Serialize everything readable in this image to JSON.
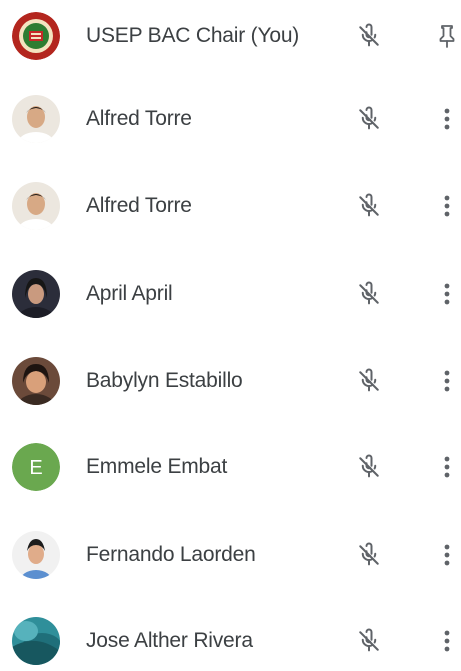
{
  "participants": [
    {
      "name": "USEP BAC Chair (You)",
      "avatar": "usep-seal",
      "mic": "mic-off-icon",
      "action": "pin-icon"
    },
    {
      "name": "Alfred Torre",
      "avatar": "photo",
      "mic": "mic-off-icon",
      "action": "more-vert-icon"
    },
    {
      "name": "Alfred Torre",
      "avatar": "photo",
      "mic": "mic-off-icon",
      "action": "more-vert-icon"
    },
    {
      "name": "April April",
      "avatar": "photo",
      "mic": "mic-off-icon",
      "action": "more-vert-icon"
    },
    {
      "name": "Babylyn Estabillo",
      "avatar": "photo",
      "mic": "mic-off-icon",
      "action": "more-vert-icon"
    },
    {
      "name": "Emmele Embat",
      "avatar": "initial",
      "initial": "E",
      "mic": "mic-off-icon",
      "action": "more-vert-icon"
    },
    {
      "name": "Fernando Laorden",
      "avatar": "photo",
      "mic": "mic-off-icon",
      "action": "more-vert-icon"
    },
    {
      "name": "Jose Alther Rivera",
      "avatar": "photo",
      "mic": "mic-off-icon",
      "action": "more-vert-icon"
    }
  ],
  "colors": {
    "text": "#3c4043",
    "icon": "#5f6368",
    "emmele_avatar": "#6aa84f"
  }
}
